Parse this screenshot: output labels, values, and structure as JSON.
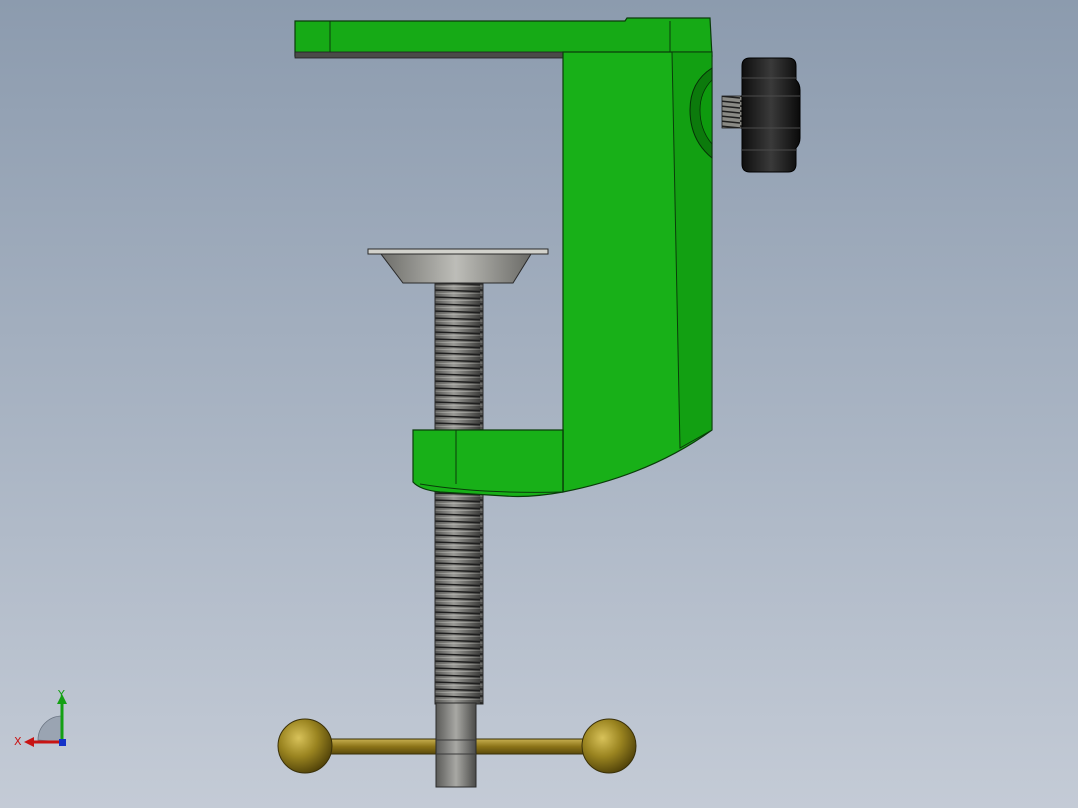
{
  "viewport": {
    "background_top": "#8c9bae",
    "background_bottom": "#c4cbd6"
  },
  "model": {
    "parts": [
      {
        "name": "clamp-frame",
        "color": "#14a814"
      },
      {
        "name": "pressure-pad",
        "color": "#8a8a85"
      },
      {
        "name": "lead-screw",
        "color": "#7a7a75"
      },
      {
        "name": "thumb-knob",
        "color": "#1a1a1a"
      },
      {
        "name": "set-spring",
        "color": "#6a6a65"
      },
      {
        "name": "t-handle",
        "color": "#9a8420"
      }
    ]
  },
  "triad": {
    "x_label": "X",
    "y_label": "Y",
    "x_color": "#c81414",
    "y_color": "#14a014",
    "z_color": "#1432c8"
  }
}
